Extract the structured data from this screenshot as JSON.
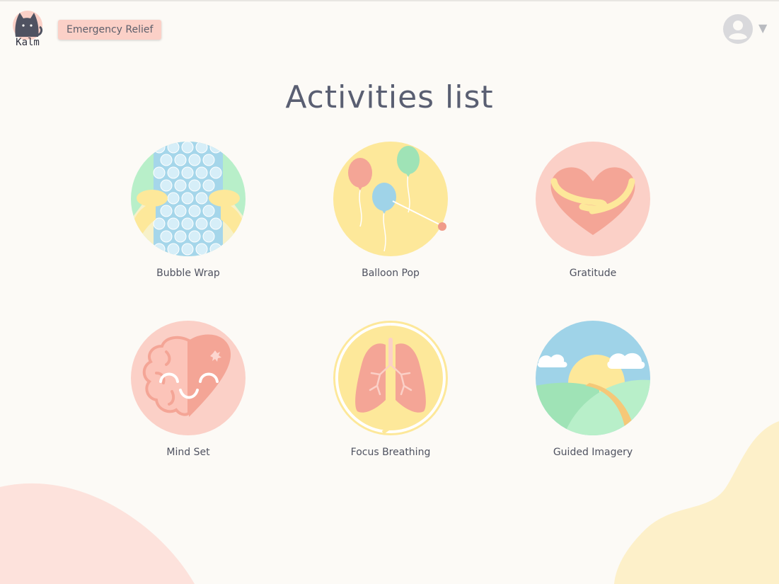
{
  "header": {
    "logo_text": "Kalm",
    "emergency_label": "Emergency Relief",
    "caret": "▼"
  },
  "page": {
    "title": "Activities list"
  },
  "activities": [
    {
      "label": "Bubble Wrap"
    },
    {
      "label": "Balloon Pop"
    },
    {
      "label": "Gratitude"
    },
    {
      "label": "Mind Set"
    },
    {
      "label": "Focus Breathing"
    },
    {
      "label": "Guided Imagery"
    }
  ],
  "colors": {
    "background": "#fcfaf6",
    "pink": "#fbd0c7",
    "yellow": "#fde89a",
    "blue": "#9fd3e8",
    "green": "#b8efc9",
    "salmon": "#f4a596",
    "title_text": "#5a5f72"
  }
}
